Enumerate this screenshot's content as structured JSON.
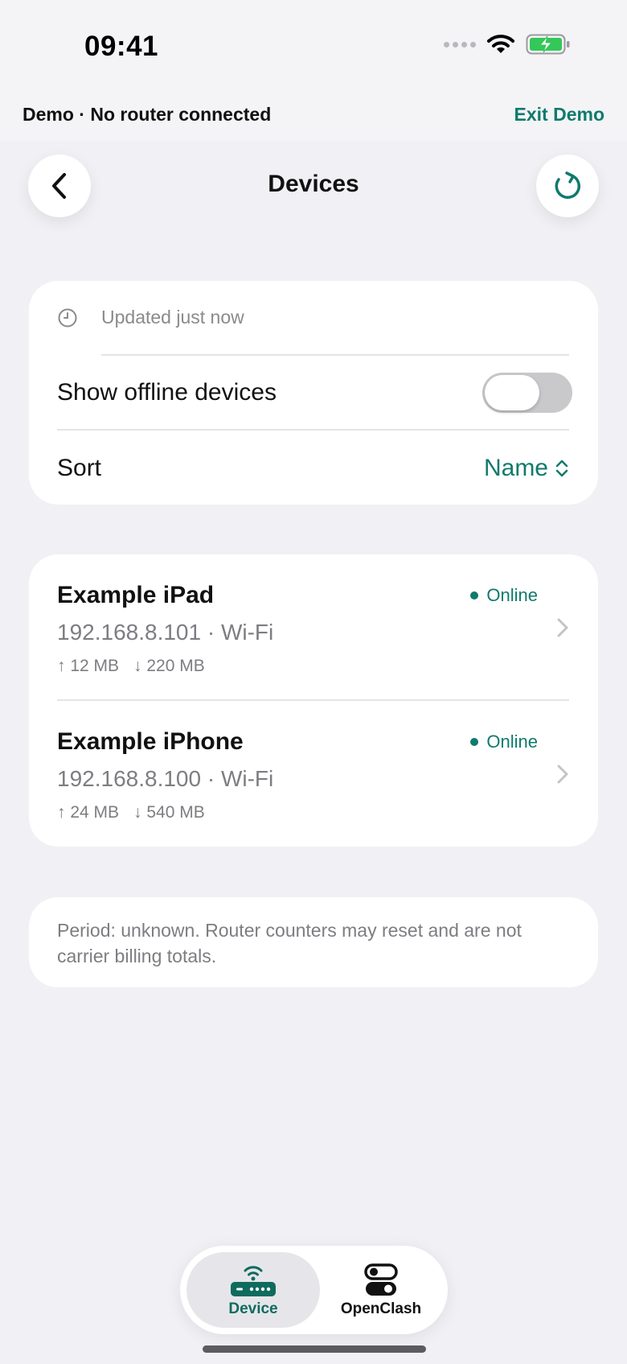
{
  "status_bar": {
    "time": "09:41"
  },
  "banner": {
    "demo_text": "Demo · No router connected",
    "exit_label": "Exit Demo"
  },
  "header": {
    "title": "Devices",
    "back_icon": "chevron-left-icon",
    "refresh_icon": "refresh-icon"
  },
  "settings": {
    "updated": "Updated just now",
    "show_offline_label": "Show offline devices",
    "show_offline_value": false,
    "sort_label": "Sort",
    "sort_value": "Name"
  },
  "devices": [
    {
      "name": "Example iPad",
      "meta": "192.168.8.101 · Wi-Fi",
      "upload": "↑ 12 MB",
      "download": "↓ 220 MB",
      "status": "Online"
    },
    {
      "name": "Example iPhone",
      "meta": "192.168.8.100 · Wi-Fi",
      "upload": "↑ 24 MB",
      "download": "↓ 540 MB",
      "status": "Online"
    }
  ],
  "note": "Period: unknown. Router counters may reset and are not carrier billing totals.",
  "tabs": [
    {
      "label": "Device",
      "icon": "router-icon",
      "selected": true
    },
    {
      "label": "OpenClash",
      "icon": "toggles-icon",
      "selected": false
    }
  ],
  "colors": {
    "accent": "#0f7a6c",
    "background": "#f0f0f5",
    "card": "#ffffff"
  }
}
